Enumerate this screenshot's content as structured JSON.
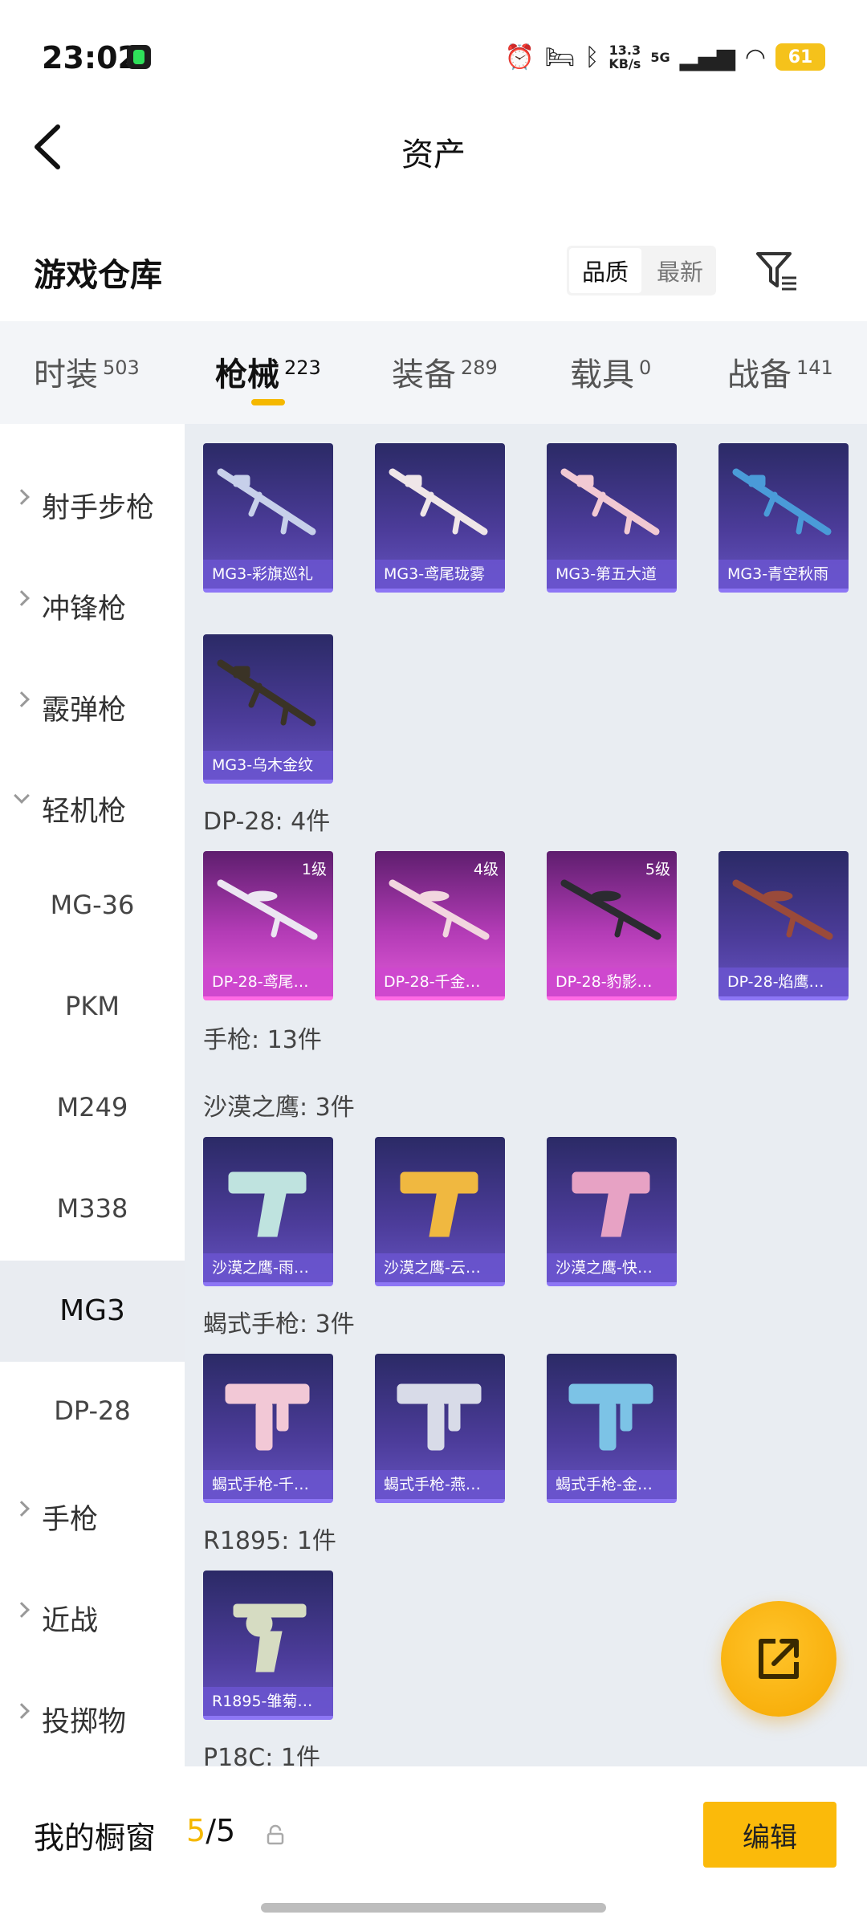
{
  "status_bar": {
    "time": "23:02",
    "speed_value": "13.3",
    "speed_unit": "KB/s",
    "network": "5G",
    "battery": "61",
    "icons": [
      "music-app-icon",
      "alarm-icon",
      "bed-icon",
      "bluetooth-icon",
      "signal-icon",
      "wifi-icon",
      "battery-icon"
    ]
  },
  "header": {
    "title": "资产",
    "back_icon": "chevron-left-icon"
  },
  "warehouse": {
    "title": "游戏仓库",
    "sort_options": [
      "品质",
      "最新"
    ],
    "selected_sort": "品质",
    "filter_icon": "filter-icon"
  },
  "tabs": [
    {
      "label": "时装",
      "count": "503"
    },
    {
      "label": "枪械",
      "count": "223"
    },
    {
      "label": "装备",
      "count": "289"
    },
    {
      "label": "载具",
      "count": "0"
    },
    {
      "label": "战备",
      "count": "141"
    }
  ],
  "active_tab": "枪械",
  "sidebar": [
    {
      "label": "射手步枪",
      "type": "category"
    },
    {
      "label": "冲锋枪",
      "type": "category"
    },
    {
      "label": "霰弹枪",
      "type": "category"
    },
    {
      "label": "轻机枪",
      "type": "category",
      "expanded": true
    },
    {
      "label": "MG-36",
      "type": "sub"
    },
    {
      "label": "PKM",
      "type": "sub"
    },
    {
      "label": "M249",
      "type": "sub"
    },
    {
      "label": "M338",
      "type": "sub"
    },
    {
      "label": "MG3",
      "type": "sub",
      "active": true
    },
    {
      "label": "DP-28",
      "type": "sub"
    },
    {
      "label": "手枪",
      "type": "category"
    },
    {
      "label": "近战",
      "type": "category"
    },
    {
      "label": "投掷物",
      "type": "category"
    }
  ],
  "items": {
    "mg3": [
      {
        "name": "MG3-彩旗巡礼",
        "color": "#c7d0ea"
      },
      {
        "name": "MG3-鸢尾珑雾",
        "color": "#efe6e8"
      },
      {
        "name": "MG3-第五大道",
        "color": "#f1c9d3"
      },
      {
        "name": "MG3-青空秋雨",
        "color": "#4a9bd8"
      },
      {
        "name": "MG3-乌木金纹",
        "color": "#3a3326"
      }
    ],
    "dp28_label": "DP-28: 4件",
    "dp28": [
      {
        "name": "DP-28-鸢尾…",
        "level": "1级",
        "color": "#ece6f2"
      },
      {
        "name": "DP-28-千金…",
        "level": "4级",
        "color": "#f2d6df"
      },
      {
        "name": "DP-28-豹影…",
        "level": "5级",
        "color": "#2b2b30"
      },
      {
        "name": "DP-28-焰鹰…",
        "level": "",
        "color": "#9a4a3a"
      }
    ],
    "pistol_label": "手枪: 13件",
    "deagle_label": "沙漠之鹰: 3件",
    "deagle": [
      {
        "name": "沙漠之鹰-雨…",
        "color": "#bfe3df"
      },
      {
        "name": "沙漠之鹰-云…",
        "color": "#f0b840"
      },
      {
        "name": "沙漠之鹰-快…",
        "color": "#e7a2c4"
      }
    ],
    "scorpion_label": "蝎式手枪: 3件",
    "scorpion": [
      {
        "name": "蝎式手枪-千…",
        "color": "#f2c8d6"
      },
      {
        "name": "蝎式手枪-燕…",
        "color": "#d8dbe8"
      },
      {
        "name": "蝎式手枪-金…",
        "color": "#7cc3e6"
      }
    ],
    "r1895_label": "R1895: 1件",
    "r1895": [
      {
        "name": "R1895-雏菊…",
        "color": "#d6dcc2"
      }
    ],
    "p18c_label": "P18C: 1件"
  },
  "fab_icon": "share-external-icon",
  "bottom": {
    "window_label": "我的橱窗",
    "count_current": "5",
    "count_sep": "/",
    "count_total": "5",
    "lock_icon": "lock-icon",
    "edit_label": "编辑"
  },
  "accent": "#f5b800"
}
